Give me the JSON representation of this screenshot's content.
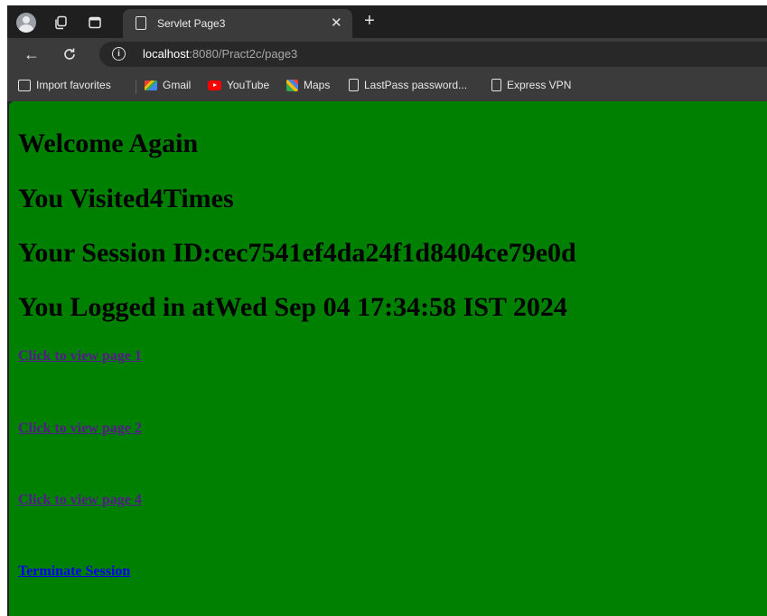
{
  "browser": {
    "tab": {
      "title": "Servlet Page3",
      "close": "✕",
      "new_tab": "+"
    },
    "toolbar": {
      "back": "←",
      "reload": "C",
      "info": "i",
      "url_host": "localhost",
      "url_rest": ":8080/Pract2c/page3"
    },
    "bookmarks": [
      {
        "label": "Import favorites",
        "icon": "import-icon"
      },
      {
        "label": "Gmail",
        "icon": "gmail-icon"
      },
      {
        "label": "YouTube",
        "icon": "youtube-icon"
      },
      {
        "label": "Maps",
        "icon": "maps-icon"
      },
      {
        "label": "LastPass password...",
        "icon": "page-icon"
      },
      {
        "label": "Express VPN",
        "icon": "page-icon"
      }
    ]
  },
  "page": {
    "background": "#008000",
    "headings": [
      "Welcome Again",
      "You Visited4Times",
      "Your Session ID:cec7541ef4da24f1d8404ce79e0d",
      "You Logged in atWed Sep 04 17:34:58 IST 2024"
    ],
    "links": [
      {
        "label": "Click to view page 1",
        "visited": true
      },
      {
        "label": "Click to view page 2",
        "visited": true
      },
      {
        "label": "Click to view page 4",
        "visited": true
      },
      {
        "label": "Terminate Session",
        "visited": false
      }
    ]
  }
}
